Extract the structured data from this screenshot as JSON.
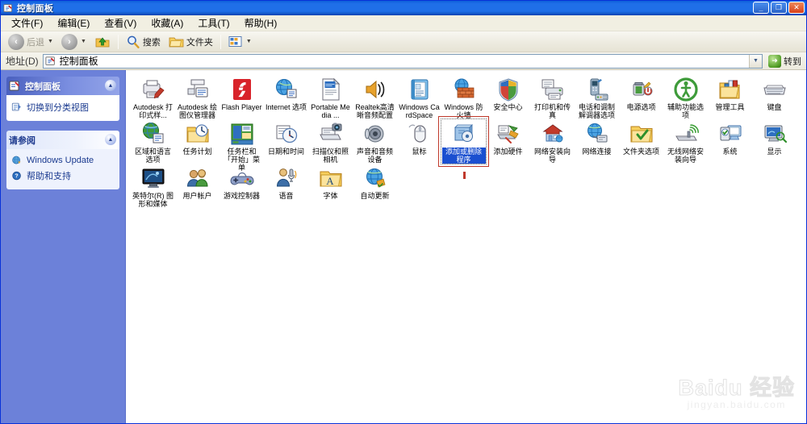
{
  "window": {
    "title": "控制面板",
    "icon": "control-panel-icon",
    "buttons": {
      "minimize": "_",
      "maximize": "❐",
      "close": "✕"
    }
  },
  "menubar": {
    "items": [
      {
        "label": "文件(F)",
        "name": "file"
      },
      {
        "label": "编辑(E)",
        "name": "edit"
      },
      {
        "label": "查看(V)",
        "name": "view"
      },
      {
        "label": "收藏(A)",
        "name": "favorites"
      },
      {
        "label": "工具(T)",
        "name": "tools"
      },
      {
        "label": "帮助(H)",
        "name": "help"
      }
    ]
  },
  "toolbar": {
    "back_label": "后退",
    "forward_label": "",
    "up_label": "",
    "search_label": "搜索",
    "folders_label": "文件夹",
    "views_label": "",
    "caret": "▼"
  },
  "addressbar": {
    "label": "地址(D)",
    "value": "控制面板",
    "placeholder": "控制面板",
    "dropdown_caret": "▼",
    "go_label": "转到",
    "go_glyph": "➜"
  },
  "sidebar": {
    "panel1": {
      "title": "控制面板",
      "chevron": "▲",
      "links": [
        {
          "label": "切换到分类视图",
          "icon": "switch-view-icon"
        }
      ]
    },
    "panel2": {
      "title": "请参阅",
      "chevron": "▲",
      "links": [
        {
          "label": "Windows Update",
          "icon": "windows-update-icon"
        },
        {
          "label": "帮助和支持",
          "icon": "help-support-icon"
        }
      ]
    }
  },
  "content": {
    "selected_item": "添加或删除程序",
    "items": [
      {
        "label": "Autodesk 打印式样...",
        "icon": "plotter-style-icon"
      },
      {
        "label": "Autodesk 绘图仪管理器",
        "icon": "plotter-manager-icon"
      },
      {
        "label": "Flash Player",
        "icon": "flash-player-icon"
      },
      {
        "label": "Internet 选项",
        "icon": "internet-options-icon"
      },
      {
        "label": "Portable Media ...",
        "icon": "portable-media-icon"
      },
      {
        "label": "Realtek高清晰音频配置",
        "icon": "realtek-audio-icon"
      },
      {
        "label": "Windows CardSpace",
        "icon": "cardspace-icon"
      },
      {
        "label": "Windows 防火墙",
        "icon": "firewall-icon"
      },
      {
        "label": "安全中心",
        "icon": "security-center-icon"
      },
      {
        "label": "打印机和传真",
        "icon": "printers-faxes-icon"
      },
      {
        "label": "电话和调制解调器选项",
        "icon": "phone-modem-icon"
      },
      {
        "label": "电源选项",
        "icon": "power-options-icon"
      },
      {
        "label": "辅助功能选项",
        "icon": "accessibility-icon"
      },
      {
        "label": "管理工具",
        "icon": "admin-tools-icon"
      },
      {
        "label": "键盘",
        "icon": "keyboard-icon"
      },
      {
        "label": "区域和语言选项",
        "icon": "regional-language-icon"
      },
      {
        "label": "任务计划",
        "icon": "scheduled-tasks-icon"
      },
      {
        "label": "任务栏和「开始」菜单",
        "icon": "taskbar-startmenu-icon"
      },
      {
        "label": "日期和时间",
        "icon": "date-time-icon"
      },
      {
        "label": "扫描仪和照相机",
        "icon": "scanners-cameras-icon"
      },
      {
        "label": "声音和音频设备",
        "icon": "sounds-audio-icon"
      },
      {
        "label": "鼠标",
        "icon": "mouse-icon"
      },
      {
        "label": "添加或删除程序",
        "icon": "add-remove-programs-icon"
      },
      {
        "label": "添加硬件",
        "icon": "add-hardware-icon"
      },
      {
        "label": "网络安装向导",
        "icon": "network-setup-wizard-icon"
      },
      {
        "label": "网络连接",
        "icon": "network-connections-icon"
      },
      {
        "label": "文件夹选项",
        "icon": "folder-options-icon"
      },
      {
        "label": "无线网络安装向导",
        "icon": "wireless-setup-icon"
      },
      {
        "label": "系统",
        "icon": "system-icon"
      },
      {
        "label": "显示",
        "icon": "display-icon"
      },
      {
        "label": "英特尔(R) 图形和媒体",
        "icon": "intel-graphics-icon"
      },
      {
        "label": "用户帐户",
        "icon": "user-accounts-icon"
      },
      {
        "label": "游戏控制器",
        "icon": "game-controllers-icon"
      },
      {
        "label": "语音",
        "icon": "speech-icon"
      },
      {
        "label": "字体",
        "icon": "fonts-icon"
      },
      {
        "label": "自动更新",
        "icon": "automatic-updates-icon"
      }
    ]
  },
  "watermark": {
    "main": "Baidu 经验",
    "sub": "jingyan.baidu.com"
  },
  "colors": {
    "title_blue": "#1f6fe8",
    "sidebar_blue": "#6c81d9",
    "selection_blue": "#1a4fd0",
    "marquee_red": "#c0392b",
    "toolbar_beige": "#eeece1"
  }
}
